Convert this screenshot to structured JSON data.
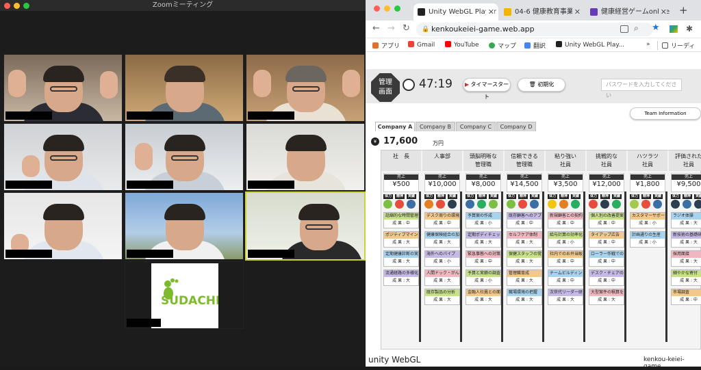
{
  "zoom": {
    "title": "Zoomミーティング"
  },
  "browser": {
    "tabs": [
      {
        "label": "Unity WebGL Player"
      },
      {
        "label": "04-6 健康教育事業ア"
      },
      {
        "label": "健康経営ゲームonline"
      }
    ],
    "url": "kenkoukeiei-game.web.app",
    "bookmarks": [
      "アプリ",
      "Gmail",
      "YouTube",
      "マップ",
      "翻訳",
      "Unity WebGL Play...",
      "リーディ"
    ]
  },
  "game": {
    "admin_label_1": "管理",
    "admin_label_2": "画面",
    "timer": "47:19",
    "timer_start": "タイマースタート",
    "reset": "初期化",
    "password_placeholder": "パスワードを入力してください",
    "team_info": "Team Information",
    "company_tabs": [
      "Company A",
      "Company B",
      "Company C",
      "Company D"
    ],
    "money": "17,600",
    "money_unit": "万円",
    "stat_labels": [
      "体力",
      "精神",
      "実績"
    ],
    "sales_label": "売上",
    "columns": [
      {
        "head1": "社　長",
        "head2": "",
        "sales": "¥500",
        "cards": [
          {
            "t": "話縮的な時間管理",
            "r": "成 果 : 中"
          },
          {
            "t": "ポジティブマインドの醸成",
            "r": "成 果 : 大"
          },
          {
            "t": "定期健康診断の実施",
            "r": "成 果 : 大"
          },
          {
            "t": "流通経路の多様化・効率化",
            "r": "成 果 : 大"
          }
        ]
      },
      {
        "head1": "人事部",
        "head2": "",
        "sales": "¥10,000",
        "cards": [
          {
            "t": "デスク周りの環境改善",
            "r": "成 果 : 中"
          },
          {
            "t": "健康保険組合の加入・運営",
            "r": "成 果 : 大"
          },
          {
            "t": "海外へのパイプ",
            "r": "成 果 : 小"
          },
          {
            "t": "人間ドック・がん検診の補助",
            "r": "成 果 : 大"
          },
          {
            "t": "既存製品の分析",
            "r": "成 果 : 大"
          }
        ]
      },
      {
        "head1": "頭脳明晰な",
        "head2": "管理職",
        "sales": "¥8,000",
        "cards": [
          {
            "t": "予算案の作成",
            "r": "成 果 : 小"
          },
          {
            "t": "定期ポディチェックの実施",
            "r": "成 果 : 大"
          },
          {
            "t": "緊急事態への対策",
            "r": "成 果 : 中"
          },
          {
            "t": "予算と実績の調査",
            "r": "成 果 : 小"
          },
          {
            "t": "金融人社員との面談",
            "r": "成 果 : 大"
          }
        ]
      },
      {
        "head1": "信頼できる",
        "head2": "管理職",
        "sales": "¥14,500",
        "cards": [
          {
            "t": "既存顧客へのアプローチ",
            "r": "成 果 : 中"
          },
          {
            "t": "セルフケア体制",
            "r": "成 果 : 大"
          },
          {
            "t": "保健スタッフの常駐",
            "r": "成 果 : 大"
          },
          {
            "t": "管理職育成",
            "r": "成 果 : 大"
          },
          {
            "t": "職場環境の把握",
            "r": "成 果 : 大"
          }
        ]
      },
      {
        "head1": "粘り強い",
        "head2": "社員",
        "sales": "¥3,500",
        "cards": [
          {
            "t": "新規顧客との契約",
            "r": "成 果 : 中"
          },
          {
            "t": "給与計算の効率化",
            "r": "成 果 : 小"
          },
          {
            "t": "社内でのお弁当販売",
            "r": "成 果 : 中"
          },
          {
            "t": "チームビルディング研修",
            "r": "成 果 : 中"
          },
          {
            "t": "次世代リーダー研修",
            "r": "成 果 : 大"
          }
        ]
      },
      {
        "head1": "挑戦的な",
        "head2": "社員",
        "sales": "¥12,000",
        "cards": [
          {
            "t": "個人別の改善提案アプリ",
            "r": "成 果 : 中"
          },
          {
            "t": "タイアップ広告",
            "r": "成 果 : 中"
          },
          {
            "t": "ローラー作戦での営業",
            "r": "成 果 : 中"
          },
          {
            "t": "デスク・チェアの正しい調整",
            "r": "成 果 : 中"
          },
          {
            "t": "大型案件の積算を発注",
            "r": "成 果 : 大"
          }
        ]
      },
      {
        "head1": "ハツラツ",
        "head2": "社員",
        "sales": "¥1,800",
        "cards": [
          {
            "t": "カスタマーサポート",
            "r": "成 果 : 小"
          },
          {
            "t": "計画通りの生産",
            "r": "成 果 : 小"
          }
        ]
      },
      {
        "head1": "評価された",
        "head2": "社員",
        "sales": "¥9,500",
        "cards": [
          {
            "t": "ラジオ体操",
            "r": "成 果 : 大"
          },
          {
            "t": "新技術の基礎研究",
            "r": "成 果 : 大"
          },
          {
            "t": "採用面接",
            "r": "成 果 : 大"
          },
          {
            "t": "細やかな寄付",
            "r": "成 果 : 大"
          },
          {
            "t": "市場調査",
            "r": "成 果 : 中"
          }
        ]
      }
    ],
    "footer_logo": "unity WebGL",
    "footer_title": "kenkou-keiei-game"
  },
  "colors": {
    "accent_blue": "#1a73e8",
    "card_blue": "#a8d3ef",
    "card_green": "#c8e08a",
    "card_orange": "#f2c98a",
    "card_purple": "#c5b9e6",
    "card_pink": "#f0b7c0"
  }
}
